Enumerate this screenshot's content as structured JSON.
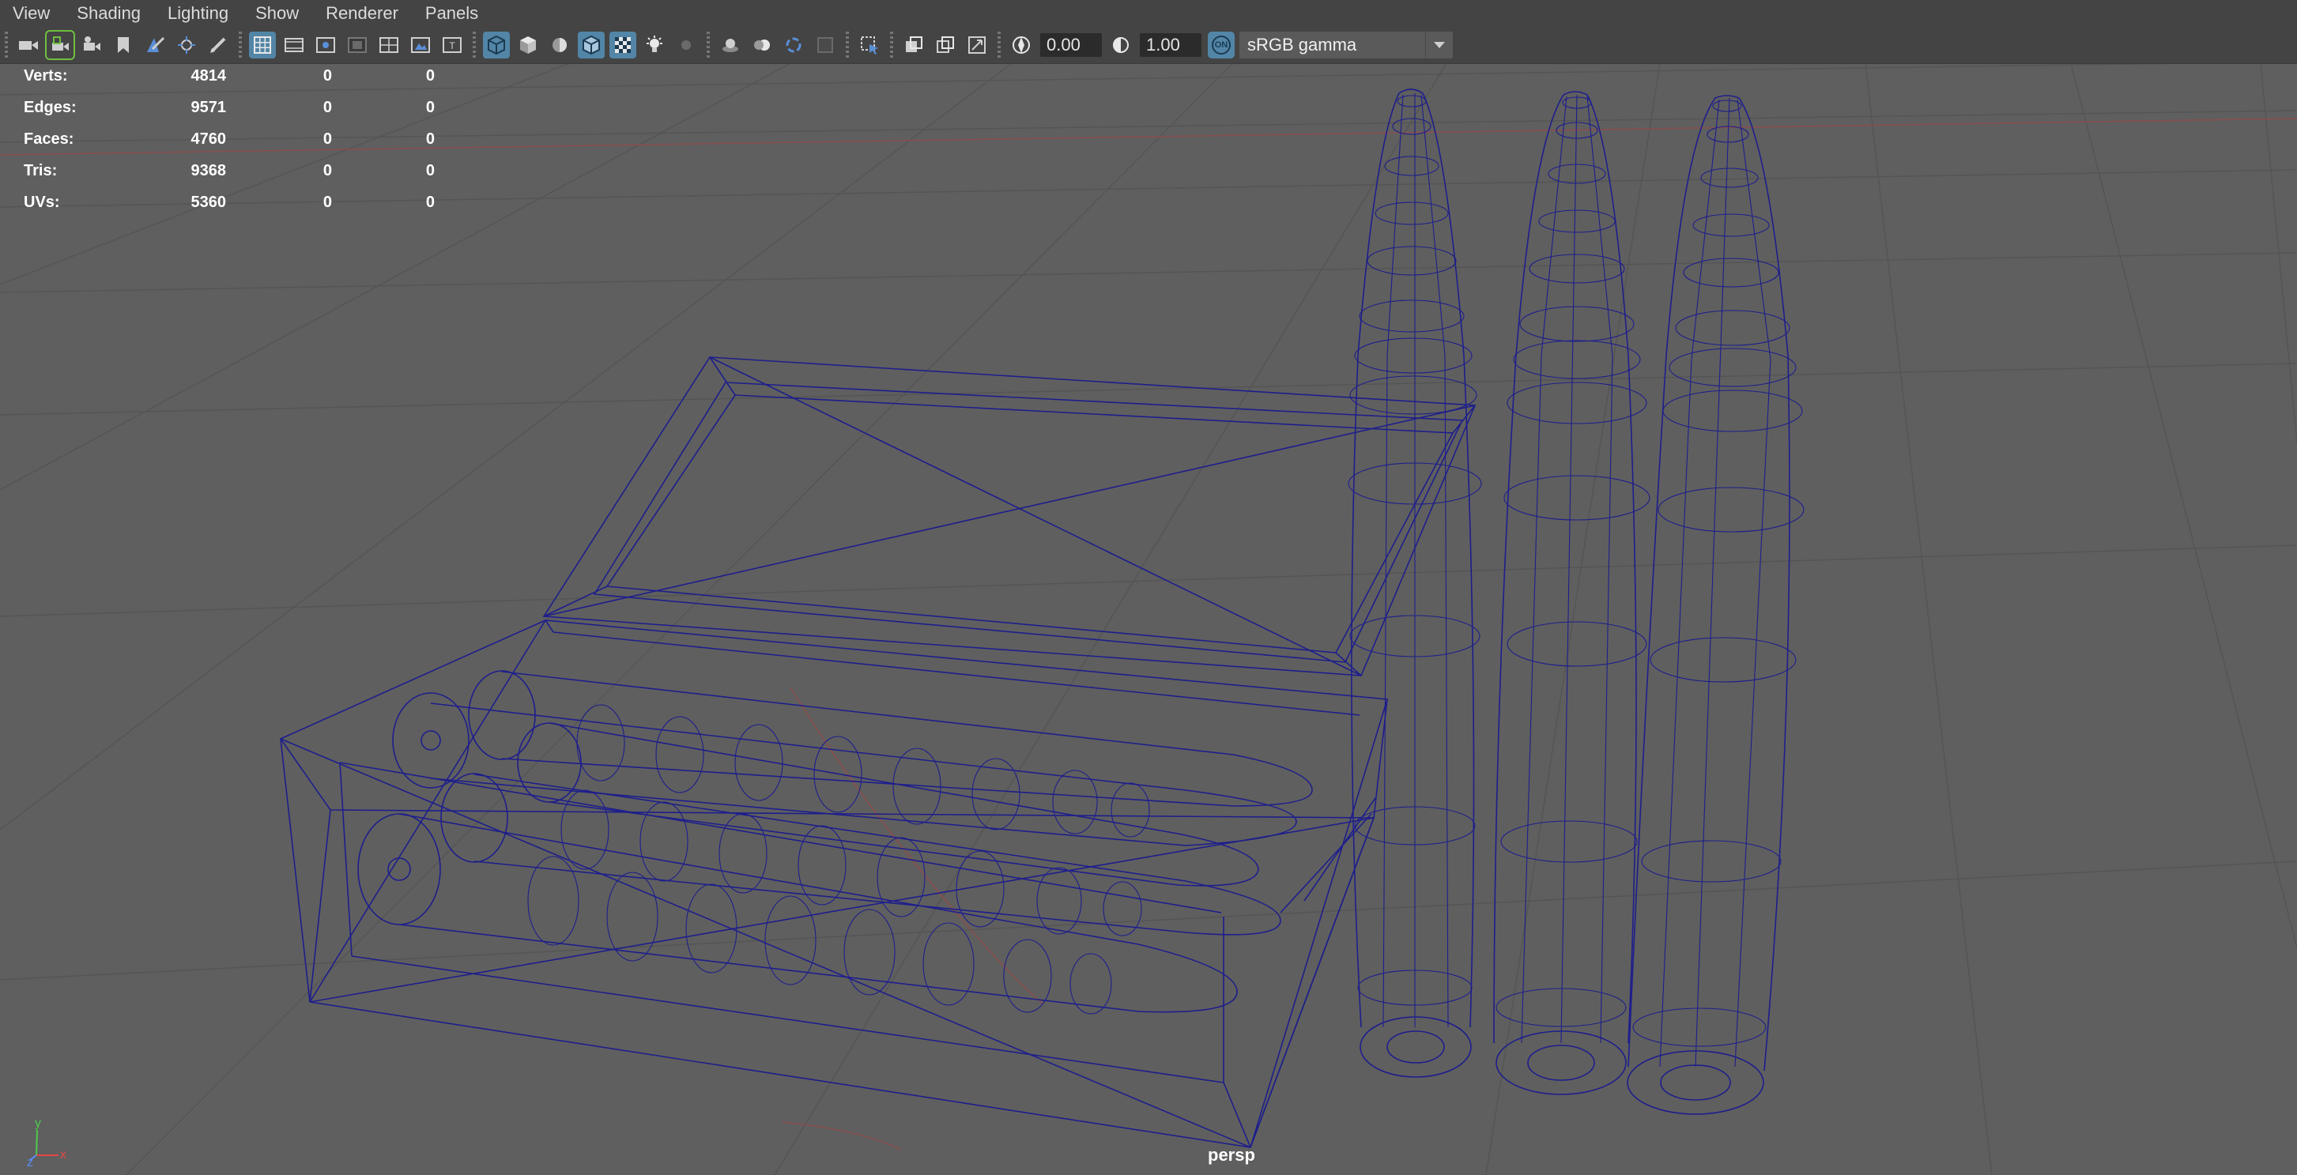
{
  "menu": [
    "View",
    "Shading",
    "Lighting",
    "Show",
    "Renderer",
    "Panels"
  ],
  "toolbar": {
    "exposure_value": "0.00",
    "gamma_value": "1.00",
    "colorspace_badge": "ON",
    "colorspace_label": "sRGB gamma"
  },
  "hud": {
    "rows": [
      {
        "label": "Verts:",
        "v1": "4814",
        "v2": "0",
        "v3": "0"
      },
      {
        "label": "Edges:",
        "v1": "9571",
        "v2": "0",
        "v3": "0"
      },
      {
        "label": "Faces:",
        "v1": "4760",
        "v2": "0",
        "v3": "0"
      },
      {
        "label": "Tris:",
        "v1": "9368",
        "v2": "0",
        "v3": "0"
      },
      {
        "label": "UVs:",
        "v1": "5360",
        "v2": "0",
        "v3": "0"
      }
    ]
  },
  "viewport": {
    "camera": "persp",
    "axis_labels": {
      "y": "y",
      "z": "z",
      "x": "x"
    }
  },
  "colors": {
    "background": "#5f5f5f",
    "menubar": "#444444",
    "grid_line": "#565656",
    "wireframe": "#1e1e8c",
    "active_button": "#5285a6",
    "axis_y": "#4ccb4c",
    "axis_x": "#e64646",
    "axis_z": "#5b8cff"
  }
}
